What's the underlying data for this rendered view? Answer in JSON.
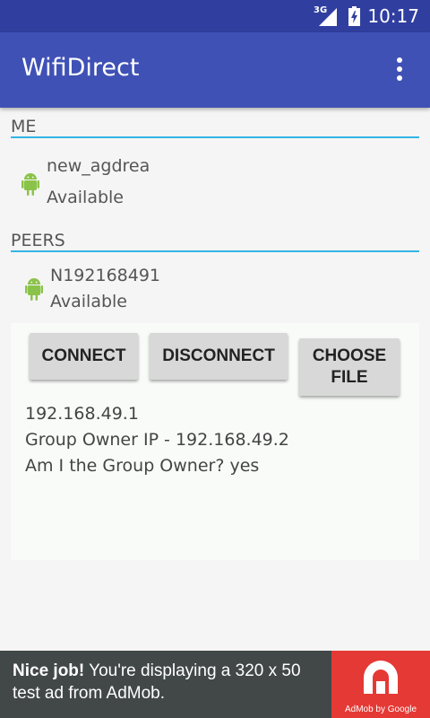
{
  "status_bar": {
    "network": "3G",
    "time": "10:17"
  },
  "app_bar": {
    "title": "WifiDirect"
  },
  "me_section": {
    "header": "ME",
    "device": {
      "name": "new_agdrea",
      "status": "Available"
    }
  },
  "peers_section": {
    "header": "PEERS",
    "devices": [
      {
        "name": "N192168491",
        "status": "Available"
      }
    ]
  },
  "detail": {
    "buttons": {
      "connect": "CONNECT",
      "disconnect": "DISCONNECT",
      "choose_file_line1": "CHOOSE",
      "choose_file_line2": "FILE"
    },
    "info_lines": [
      "192.168.49.1",
      "Group Owner IP - 192.168.49.2",
      "Am I the Group Owner? yes"
    ]
  },
  "ad": {
    "bold": "Nice job!",
    "text": " You're displaying a 320 x 50 test ad from AdMob.",
    "logo_caption": "AdMob by Google"
  },
  "colors": {
    "status_bar": "#303f9f",
    "app_bar": "#3f51b5",
    "divider": "#33b5e5",
    "android_icon": "#8bc34a",
    "ad_background": "#424848",
    "ad_logo": "#e53935"
  }
}
